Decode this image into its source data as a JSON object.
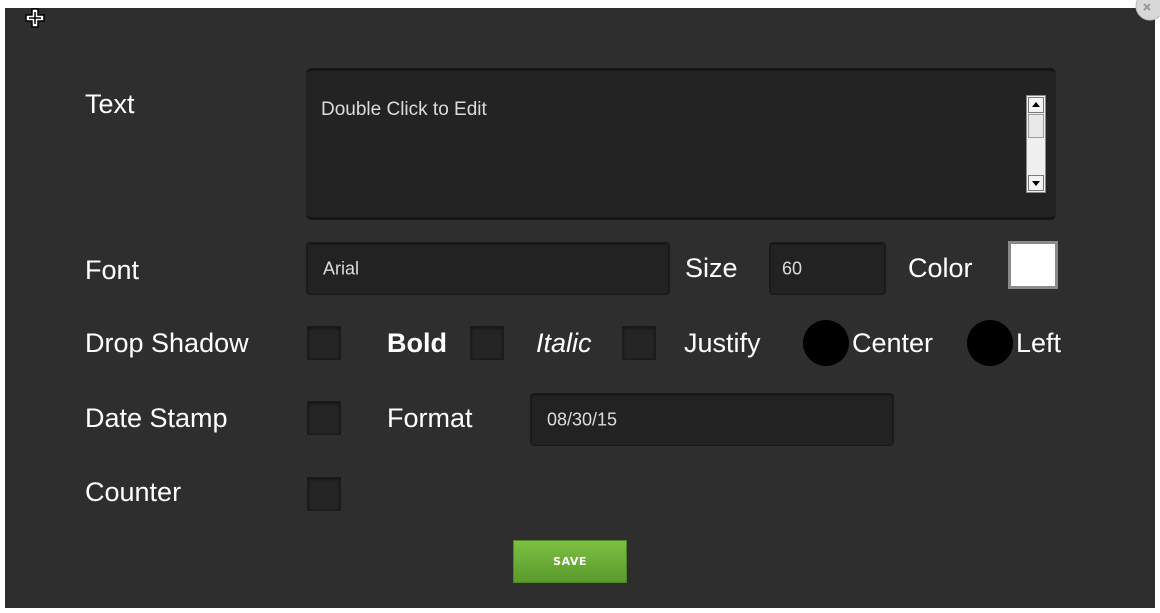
{
  "labels": {
    "text": "Text",
    "font": "Font",
    "size": "Size",
    "color": "Color",
    "drop_shadow": "Drop Shadow",
    "bold": "Bold",
    "italic": "Italic",
    "justify": "Justify",
    "center": "Center",
    "left": "Left",
    "date_stamp": "Date Stamp",
    "format": "Format",
    "counter": "Counter"
  },
  "fields": {
    "text_value": "Double Click to Edit",
    "font_value": "Arial",
    "size_value": "60",
    "format_value": "08/30/15",
    "color_value": "#ffffff"
  },
  "checkboxes": {
    "drop_shadow": false,
    "bold": false,
    "italic": false,
    "date_stamp": false,
    "counter": false
  },
  "buttons": {
    "save": "SAVE"
  },
  "icons": {
    "move": "move-icon",
    "close": "close-icon"
  }
}
